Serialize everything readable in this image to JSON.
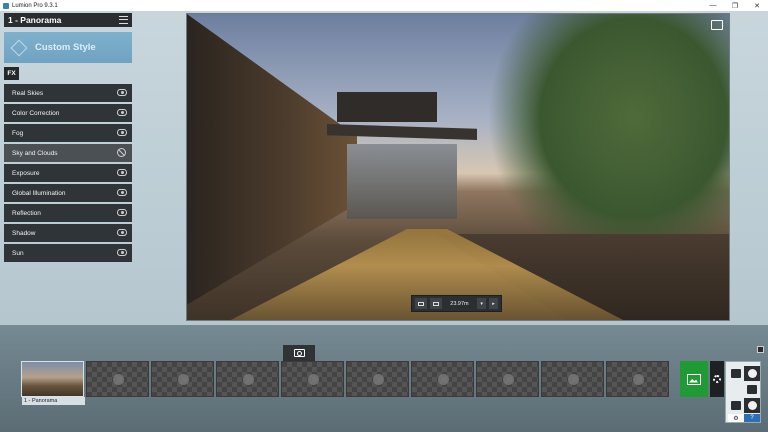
{
  "window": {
    "title": "Lumion Pro 9.3.1",
    "controls": [
      "—",
      "❐",
      "✕"
    ]
  },
  "panel": {
    "title": "1 - Panorama",
    "style_button": "Custom Style",
    "tab": "FX",
    "effects": [
      {
        "label": "Real Skies",
        "icon": "eye-icon"
      },
      {
        "label": "Color Correction",
        "icon": "eye-icon"
      },
      {
        "label": "Fog",
        "icon": "eye-icon"
      },
      {
        "label": "Sky and Clouds",
        "icon": "eye-off-icon"
      },
      {
        "label": "Exposure",
        "icon": "eye-icon"
      },
      {
        "label": "Global Illumination",
        "icon": "eye-icon"
      },
      {
        "label": "Reflection",
        "icon": "eye-icon"
      },
      {
        "label": "Shadow",
        "icon": "eye-icon"
      },
      {
        "label": "Sun",
        "icon": "eye-icon"
      }
    ]
  },
  "viewport": {
    "camera_height": "23.97m"
  },
  "timeline": {
    "slots": [
      {
        "label": "1 - Panorama",
        "filled": true
      },
      {
        "label": "",
        "filled": false
      },
      {
        "label": "",
        "filled": false
      },
      {
        "label": "",
        "filled": false
      },
      {
        "label": "",
        "filled": false
      },
      {
        "label": "",
        "filled": false
      },
      {
        "label": "",
        "filled": false
      },
      {
        "label": "",
        "filled": false
      },
      {
        "label": "",
        "filled": false
      },
      {
        "label": "",
        "filled": false
      }
    ]
  },
  "mode_panel": {
    "help_label": "?"
  },
  "colors": {
    "render_green": "#1f9a34",
    "custom_style_blue": "#7fb1cd",
    "panel_dark": "#2f3438"
  }
}
